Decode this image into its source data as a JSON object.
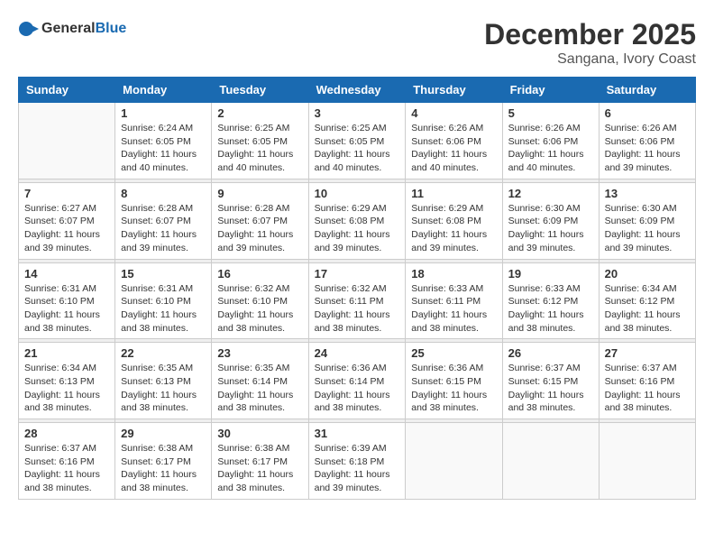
{
  "header": {
    "logo_general": "General",
    "logo_blue": "Blue",
    "month_title": "December 2025",
    "location": "Sangana, Ivory Coast"
  },
  "weekdays": [
    "Sunday",
    "Monday",
    "Tuesday",
    "Wednesday",
    "Thursday",
    "Friday",
    "Saturday"
  ],
  "weeks": [
    [
      {
        "day": "",
        "info": ""
      },
      {
        "day": "1",
        "info": "Sunrise: 6:24 AM\nSunset: 6:05 PM\nDaylight: 11 hours and 40 minutes."
      },
      {
        "day": "2",
        "info": "Sunrise: 6:25 AM\nSunset: 6:05 PM\nDaylight: 11 hours and 40 minutes."
      },
      {
        "day": "3",
        "info": "Sunrise: 6:25 AM\nSunset: 6:05 PM\nDaylight: 11 hours and 40 minutes."
      },
      {
        "day": "4",
        "info": "Sunrise: 6:26 AM\nSunset: 6:06 PM\nDaylight: 11 hours and 40 minutes."
      },
      {
        "day": "5",
        "info": "Sunrise: 6:26 AM\nSunset: 6:06 PM\nDaylight: 11 hours and 40 minutes."
      },
      {
        "day": "6",
        "info": "Sunrise: 6:26 AM\nSunset: 6:06 PM\nDaylight: 11 hours and 39 minutes."
      }
    ],
    [
      {
        "day": "7",
        "info": "Sunrise: 6:27 AM\nSunset: 6:07 PM\nDaylight: 11 hours and 39 minutes."
      },
      {
        "day": "8",
        "info": "Sunrise: 6:28 AM\nSunset: 6:07 PM\nDaylight: 11 hours and 39 minutes."
      },
      {
        "day": "9",
        "info": "Sunrise: 6:28 AM\nSunset: 6:07 PM\nDaylight: 11 hours and 39 minutes."
      },
      {
        "day": "10",
        "info": "Sunrise: 6:29 AM\nSunset: 6:08 PM\nDaylight: 11 hours and 39 minutes."
      },
      {
        "day": "11",
        "info": "Sunrise: 6:29 AM\nSunset: 6:08 PM\nDaylight: 11 hours and 39 minutes."
      },
      {
        "day": "12",
        "info": "Sunrise: 6:30 AM\nSunset: 6:09 PM\nDaylight: 11 hours and 39 minutes."
      },
      {
        "day": "13",
        "info": "Sunrise: 6:30 AM\nSunset: 6:09 PM\nDaylight: 11 hours and 39 minutes."
      }
    ],
    [
      {
        "day": "14",
        "info": "Sunrise: 6:31 AM\nSunset: 6:10 PM\nDaylight: 11 hours and 38 minutes."
      },
      {
        "day": "15",
        "info": "Sunrise: 6:31 AM\nSunset: 6:10 PM\nDaylight: 11 hours and 38 minutes."
      },
      {
        "day": "16",
        "info": "Sunrise: 6:32 AM\nSunset: 6:10 PM\nDaylight: 11 hours and 38 minutes."
      },
      {
        "day": "17",
        "info": "Sunrise: 6:32 AM\nSunset: 6:11 PM\nDaylight: 11 hours and 38 minutes."
      },
      {
        "day": "18",
        "info": "Sunrise: 6:33 AM\nSunset: 6:11 PM\nDaylight: 11 hours and 38 minutes."
      },
      {
        "day": "19",
        "info": "Sunrise: 6:33 AM\nSunset: 6:12 PM\nDaylight: 11 hours and 38 minutes."
      },
      {
        "day": "20",
        "info": "Sunrise: 6:34 AM\nSunset: 6:12 PM\nDaylight: 11 hours and 38 minutes."
      }
    ],
    [
      {
        "day": "21",
        "info": "Sunrise: 6:34 AM\nSunset: 6:13 PM\nDaylight: 11 hours and 38 minutes."
      },
      {
        "day": "22",
        "info": "Sunrise: 6:35 AM\nSunset: 6:13 PM\nDaylight: 11 hours and 38 minutes."
      },
      {
        "day": "23",
        "info": "Sunrise: 6:35 AM\nSunset: 6:14 PM\nDaylight: 11 hours and 38 minutes."
      },
      {
        "day": "24",
        "info": "Sunrise: 6:36 AM\nSunset: 6:14 PM\nDaylight: 11 hours and 38 minutes."
      },
      {
        "day": "25",
        "info": "Sunrise: 6:36 AM\nSunset: 6:15 PM\nDaylight: 11 hours and 38 minutes."
      },
      {
        "day": "26",
        "info": "Sunrise: 6:37 AM\nSunset: 6:15 PM\nDaylight: 11 hours and 38 minutes."
      },
      {
        "day": "27",
        "info": "Sunrise: 6:37 AM\nSunset: 6:16 PM\nDaylight: 11 hours and 38 minutes."
      }
    ],
    [
      {
        "day": "28",
        "info": "Sunrise: 6:37 AM\nSunset: 6:16 PM\nDaylight: 11 hours and 38 minutes."
      },
      {
        "day": "29",
        "info": "Sunrise: 6:38 AM\nSunset: 6:17 PM\nDaylight: 11 hours and 38 minutes."
      },
      {
        "day": "30",
        "info": "Sunrise: 6:38 AM\nSunset: 6:17 PM\nDaylight: 11 hours and 38 minutes."
      },
      {
        "day": "31",
        "info": "Sunrise: 6:39 AM\nSunset: 6:18 PM\nDaylight: 11 hours and 39 minutes."
      },
      {
        "day": "",
        "info": ""
      },
      {
        "day": "",
        "info": ""
      },
      {
        "day": "",
        "info": ""
      }
    ]
  ]
}
